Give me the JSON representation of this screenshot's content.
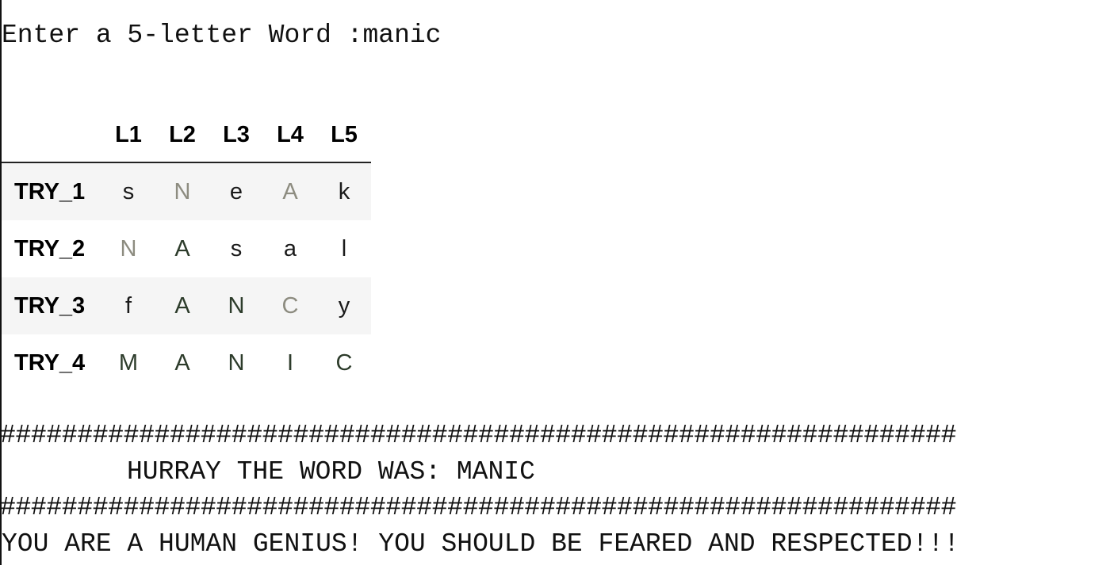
{
  "prompt": {
    "text": "Enter a 5-letter Word :manic"
  },
  "table": {
    "headers": [
      "L1",
      "L2",
      "L3",
      "L4",
      "L5"
    ],
    "rows": [
      {
        "label": "TRY_1",
        "cells": [
          {
            "letter": "s",
            "status": "absent"
          },
          {
            "letter": "N",
            "status": "present"
          },
          {
            "letter": "e",
            "status": "absent"
          },
          {
            "letter": "A",
            "status": "present"
          },
          {
            "letter": "k",
            "status": "absent"
          }
        ]
      },
      {
        "label": "TRY_2",
        "cells": [
          {
            "letter": "N",
            "status": "present"
          },
          {
            "letter": "A",
            "status": "correct"
          },
          {
            "letter": "s",
            "status": "absent"
          },
          {
            "letter": "a",
            "status": "absent"
          },
          {
            "letter": "l",
            "status": "absent"
          }
        ]
      },
      {
        "label": "TRY_3",
        "cells": [
          {
            "letter": "f",
            "status": "absent"
          },
          {
            "letter": "A",
            "status": "correct"
          },
          {
            "letter": "N",
            "status": "correct"
          },
          {
            "letter": "C",
            "status": "present"
          },
          {
            "letter": "y",
            "status": "absent"
          }
        ]
      },
      {
        "label": "TRY_4",
        "cells": [
          {
            "letter": "M",
            "status": "correct"
          },
          {
            "letter": "A",
            "status": "correct"
          },
          {
            "letter": "N",
            "status": "correct"
          },
          {
            "letter": "I",
            "status": "correct"
          },
          {
            "letter": "C",
            "status": "correct"
          }
        ]
      }
    ]
  },
  "separator": "##############################################################",
  "result": {
    "text": "HURRAY THE WORD WAS: MANIC"
  },
  "message": {
    "text": "YOU ARE A HUMAN GENIUS! YOU SHOULD BE FEARED AND RESPECTED!!!"
  },
  "colors": {
    "absent": "#1a1a1a",
    "correct": "#2d3c2b",
    "present": "#8d8c80",
    "row_stripe": "#f5f5f5",
    "text": "#111111"
  }
}
